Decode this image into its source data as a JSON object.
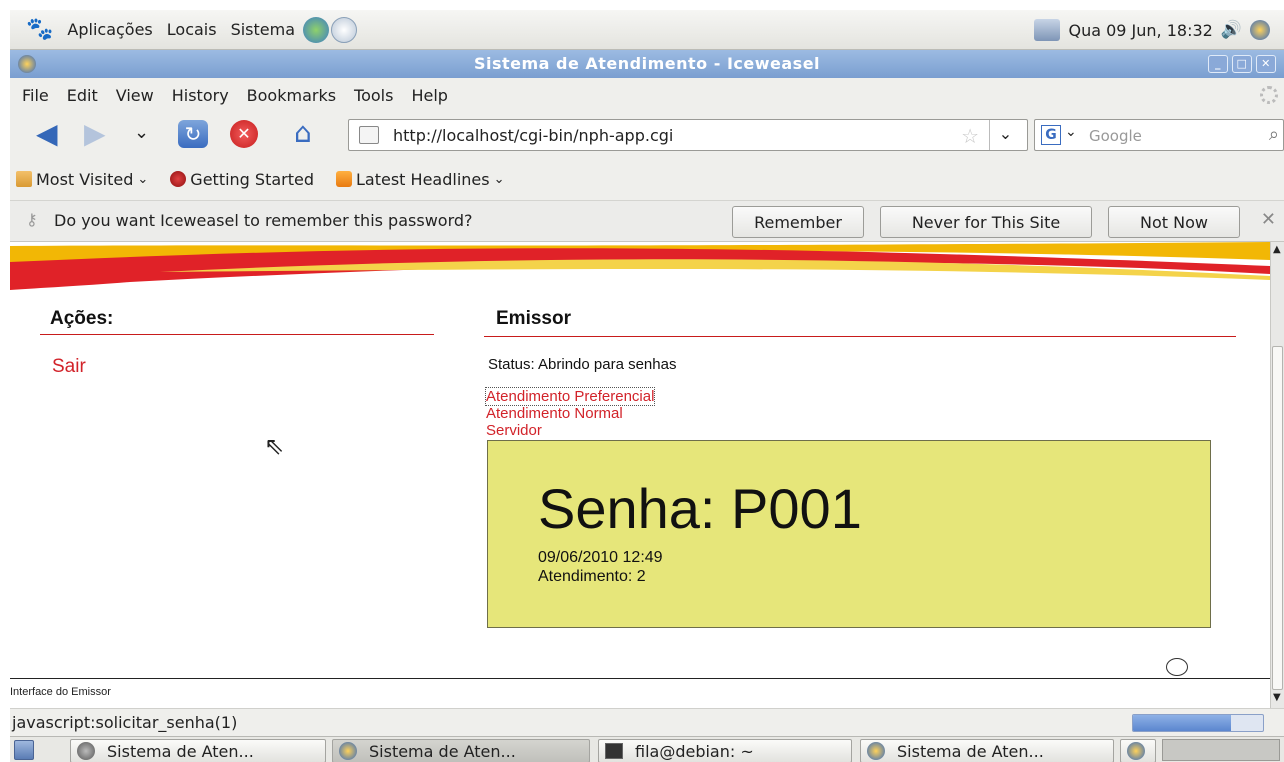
{
  "gnome_panel": {
    "menus": [
      "Aplicações",
      "Locais",
      "Sistema"
    ],
    "clock": "Qua 09 Jun, 18:32"
  },
  "window": {
    "title": "Sistema de Atendimento - Iceweasel"
  },
  "menubar": {
    "items": [
      "File",
      "Edit",
      "View",
      "History",
      "Bookmarks",
      "Tools",
      "Help"
    ]
  },
  "navigation": {
    "url": "http://localhost/cgi-bin/nph-app.cgi",
    "search_placeholder": "Google"
  },
  "bookmarks": {
    "items": [
      "Most Visited",
      "Getting Started",
      "Latest Headlines"
    ]
  },
  "password_bar": {
    "message": "Do you want Iceweasel to remember this password?",
    "remember": "Remember",
    "never": "Never for This Site",
    "not_now": "Not Now"
  },
  "page": {
    "acoes_title": "Ações:",
    "sair_link": "Sair",
    "emissor_title": "Emissor",
    "status": "Status: Abrindo para senhas",
    "links": [
      "Atendimento Preferencial",
      "Atendimento Normal",
      "Servidor"
    ],
    "senha": {
      "label": "Senha: P001",
      "datetime": "09/06/2010 12:49",
      "atendimento": "Atendimento: 2"
    },
    "footer_label": "Interface do Emissor"
  },
  "status_bar": {
    "text": "javascript:solicitar_senha(1)",
    "progress": 0.75
  },
  "taskbar": {
    "tasks": [
      "Sistema de Aten...",
      "Sistema de Aten...",
      "fila@debian: ~",
      "Sistema de Aten..."
    ]
  },
  "colors": {
    "accent_red": "#d2232a",
    "ticket_bg": "#e6e67a",
    "title_bar": "#7a9ed0"
  }
}
